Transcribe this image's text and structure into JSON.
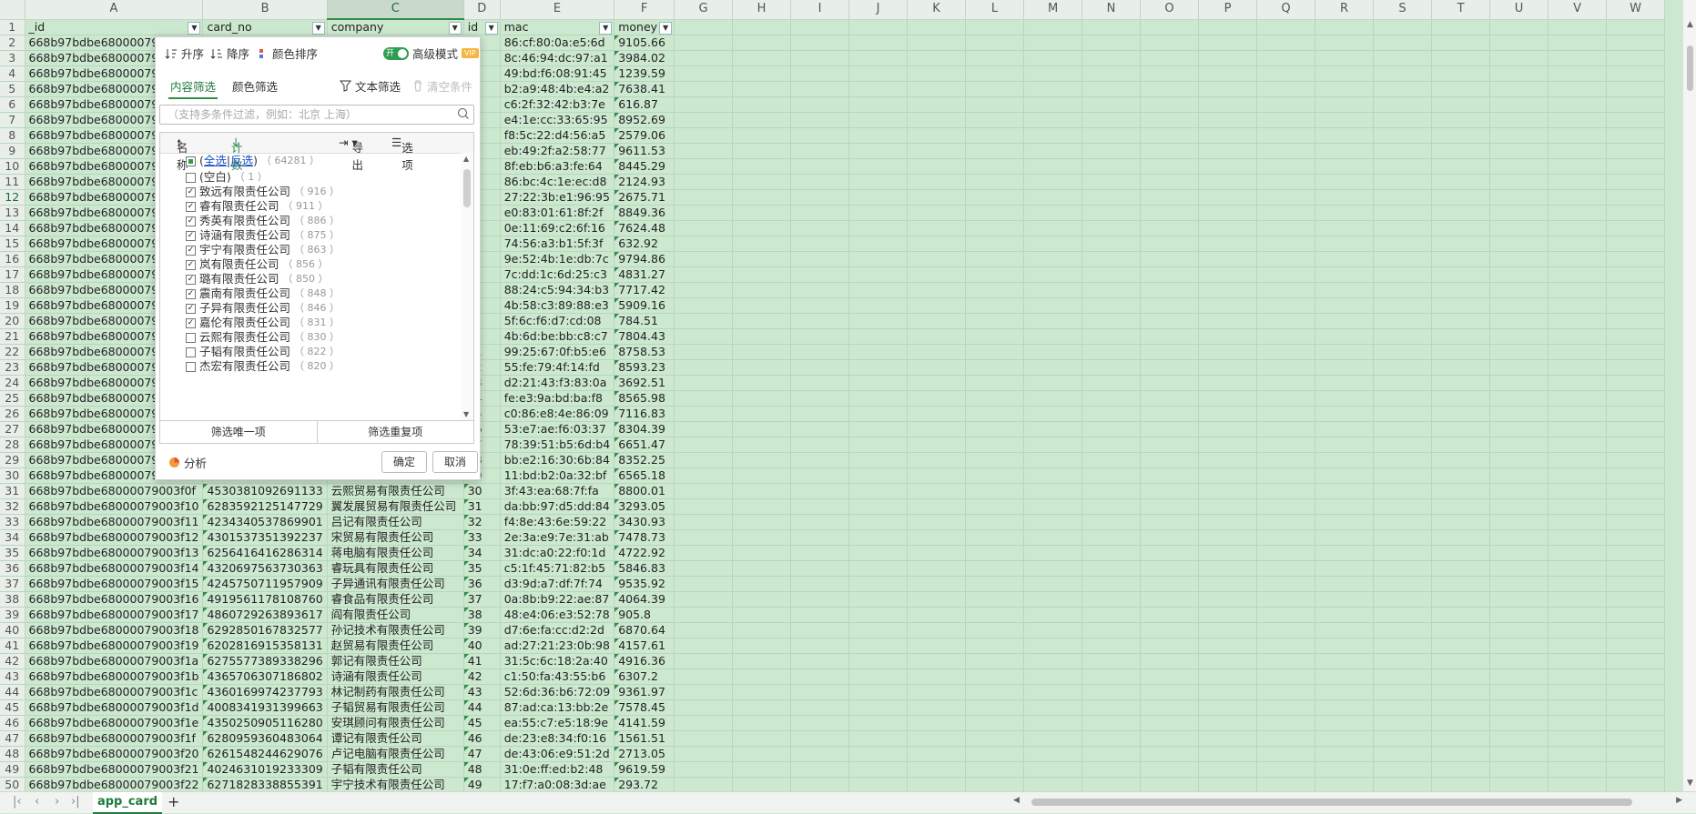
{
  "columns": [
    "A",
    "B",
    "C",
    "D",
    "E",
    "F",
    "G",
    "H",
    "I",
    "J",
    "K",
    "L",
    "M",
    "N",
    "O",
    "P",
    "Q",
    "R",
    "S",
    "T",
    "U",
    "V",
    "W"
  ],
  "headers": {
    "A": "_id",
    "B": "card_no",
    "C": "company",
    "D": "id",
    "E": "mac",
    "F": "money"
  },
  "rows": [
    {
      "r": "2",
      "a": "668b97bdbe68000079",
      "b": "",
      "c": "",
      "d": "",
      "e": "86:cf:80:0a:e5:6d",
      "f": "9105.66"
    },
    {
      "r": "3",
      "a": "668b97bdbe68000079",
      "b": "",
      "c": "",
      "d": "",
      "e": "8c:46:94:dc:97:a1",
      "f": "3984.02"
    },
    {
      "r": "4",
      "a": "668b97bdbe68000079",
      "b": "",
      "c": "",
      "d": "",
      "e": "49:bd:f6:08:91:45",
      "f": "1239.59"
    },
    {
      "r": "5",
      "a": "668b97bdbe68000079",
      "b": "",
      "c": "",
      "d": "",
      "e": "b2:a9:48:4b:e4:a2",
      "f": "7638.41"
    },
    {
      "r": "6",
      "a": "668b97bdbe68000079",
      "b": "",
      "c": "",
      "d": "",
      "e": "c6:2f:32:42:b3:7e",
      "f": "616.87"
    },
    {
      "r": "7",
      "a": "668b97bdbe68000079",
      "b": "",
      "c": "",
      "d": "",
      "e": "e4:1e:cc:33:65:95",
      "f": "8952.69"
    },
    {
      "r": "8",
      "a": "668b97bdbe68000079",
      "b": "",
      "c": "",
      "d": "",
      "e": "f8:5c:22:d4:56:a5",
      "f": "2579.06"
    },
    {
      "r": "9",
      "a": "668b97bdbe68000079",
      "b": "",
      "c": "",
      "d": "",
      "e": "eb:49:2f:a2:58:77",
      "f": "9611.53"
    },
    {
      "r": "10",
      "a": "668b97bdbe68000079",
      "b": "",
      "c": "",
      "d": "",
      "e": "8f:eb:b6:a3:fe:64",
      "f": "8445.29"
    },
    {
      "r": "11",
      "a": "668b97bdbe68000079",
      "b": "",
      "c": "",
      "d": "",
      "e": "86:bc:4c:1e:ec:d8",
      "f": "2124.93"
    },
    {
      "r": "12",
      "a": "668b97bdbe68000079",
      "b": "",
      "c": "",
      "d": "",
      "e": "27:22:3b:e1:96:95",
      "f": "2675.71"
    },
    {
      "r": "13",
      "a": "668b97bdbe68000079",
      "b": "",
      "c": "",
      "d": "",
      "e": "e0:83:01:61:8f:2f",
      "f": "8849.36"
    },
    {
      "r": "14",
      "a": "668b97bdbe68000079",
      "b": "",
      "c": "",
      "d": "",
      "e": "0e:11:69:c2:6f:16",
      "f": "7624.48"
    },
    {
      "r": "15",
      "a": "668b97bdbe68000079",
      "b": "",
      "c": "",
      "d": "",
      "e": "74:56:a3:b1:5f:3f",
      "f": "632.92"
    },
    {
      "r": "16",
      "a": "668b97bdbe68000079",
      "b": "",
      "c": "",
      "d": "",
      "e": "9e:52:4b:1e:db:7c",
      "f": "9794.86"
    },
    {
      "r": "17",
      "a": "668b97bdbe68000079",
      "b": "",
      "c": "",
      "d": "",
      "e": "7c:dd:1c:6d:25:c3",
      "f": "4831.27"
    },
    {
      "r": "18",
      "a": "668b97bdbe68000079",
      "b": "",
      "c": "",
      "d": "",
      "e": "88:24:c5:94:34:b3",
      "f": "7717.42"
    },
    {
      "r": "19",
      "a": "668b97bdbe68000079",
      "b": "",
      "c": "",
      "d": "",
      "e": "4b:58:c3:89:88:e3",
      "f": "5909.16"
    },
    {
      "r": "20",
      "a": "668b97bdbe68000079",
      "b": "",
      "c": "",
      "d": "",
      "e": "5f:6c:f6:d7:cd:08",
      "f": "784.51"
    },
    {
      "r": "21",
      "a": "668b97bdbe68000079",
      "b": "",
      "c": "",
      "d": "",
      "e": "4b:6d:be:bb:c8:c7",
      "f": "7804.43"
    },
    {
      "r": "22",
      "a": "668b97bdbe68000079",
      "b": "",
      "c": "",
      "d": "21",
      "e": "99:25:67:0f:b5:e6",
      "f": "8758.53"
    },
    {
      "r": "23",
      "a": "668b97bdbe68000079",
      "b": "",
      "c": "",
      "d": "22",
      "e": "55:fe:79:4f:14:fd",
      "f": "8593.23"
    },
    {
      "r": "24",
      "a": "668b97bdbe68000079",
      "b": "",
      "c": "",
      "d": "23",
      "e": "d2:21:43:f3:83:0a",
      "f": "3692.51"
    },
    {
      "r": "25",
      "a": "668b97bdbe68000079",
      "b": "",
      "c": "",
      "d": "24",
      "e": "fe:e3:9a:bd:ba:f8",
      "f": "8565.98"
    },
    {
      "r": "26",
      "a": "668b97bdbe68000079",
      "b": "",
      "c": "",
      "d": "25",
      "e": "c0:86:e8:4e:86:09",
      "f": "7116.83"
    },
    {
      "r": "27",
      "a": "668b97bdbe68000079",
      "b": "",
      "c": "",
      "d": "26",
      "e": "53:e7:ae:f6:03:37",
      "f": "8304.39"
    },
    {
      "r": "28",
      "a": "668b97bdbe68000079",
      "b": "",
      "c": "",
      "d": "27",
      "e": "78:39:51:b5:6d:b4",
      "f": "6651.47"
    },
    {
      "r": "29",
      "a": "668b97bdbe68000079",
      "b": "",
      "c": "",
      "d": "28",
      "e": "bb:e2:16:30:6b:84",
      "f": "8352.25"
    },
    {
      "r": "30",
      "a": "668b97bdbe68000079",
      "b": "",
      "c": "",
      "d": "29",
      "e": "11:bd:b2:0a:32:bf",
      "f": "6565.18"
    },
    {
      "r": "31",
      "a": "668b97bdbe68000079003f0f",
      "b": "4530381092691133",
      "c": "云熙贸易有限责任公司",
      "d": "30",
      "e": "3f:43:ea:68:7f:fa",
      "f": "8800.01"
    },
    {
      "r": "32",
      "a": "668b97bdbe68000079003f10",
      "b": "6283592125147729",
      "c": "翼发展贸易有限责任公司",
      "d": "31",
      "e": "da:bb:97:d5:dd:84",
      "f": "3293.05"
    },
    {
      "r": "33",
      "a": "668b97bdbe68000079003f11",
      "b": "4234340537869901",
      "c": "吕记有限责任公司",
      "d": "32",
      "e": "f4:8e:43:6e:59:22",
      "f": "3430.93"
    },
    {
      "r": "34",
      "a": "668b97bdbe68000079003f12",
      "b": "4301537351392237",
      "c": "宋贸易有限责任公司",
      "d": "33",
      "e": "2e:3a:e9:7e:31:ab",
      "f": "7478.73"
    },
    {
      "r": "35",
      "a": "668b97bdbe68000079003f13",
      "b": "6256416416286314",
      "c": "蒋电脑有限责任公司",
      "d": "34",
      "e": "31:dc:a0:22:f0:1d",
      "f": "4722.92"
    },
    {
      "r": "36",
      "a": "668b97bdbe68000079003f14",
      "b": "4320697563730363",
      "c": "睿玩具有限责任公司",
      "d": "35",
      "e": "c5:1f:45:71:82:b5",
      "f": "5846.83"
    },
    {
      "r": "37",
      "a": "668b97bdbe68000079003f15",
      "b": "4245750711957909",
      "c": "子异通讯有限责任公司",
      "d": "36",
      "e": "d3:9d:a7:df:7f:74",
      "f": "9535.92"
    },
    {
      "r": "38",
      "a": "668b97bdbe68000079003f16",
      "b": "4919561178108760",
      "c": "睿食品有限责任公司",
      "d": "37",
      "e": "0a:8b:b9:22:ae:87",
      "f": "4064.39"
    },
    {
      "r": "39",
      "a": "668b97bdbe68000079003f17",
      "b": "4860729263893617",
      "c": "阎有限责任公司",
      "d": "38",
      "e": "48:e4:06:e3:52:78",
      "f": "905.8"
    },
    {
      "r": "40",
      "a": "668b97bdbe68000079003f18",
      "b": "6292850167832577",
      "c": "孙记技术有限责任公司",
      "d": "39",
      "e": "d7:6e:fa:cc:d2:2d",
      "f": "6870.64"
    },
    {
      "r": "41",
      "a": "668b97bdbe68000079003f19",
      "b": "6202816915358131",
      "c": "赵贸易有限责任公司",
      "d": "40",
      "e": "ad:27:21:23:0b:98",
      "f": "4157.61"
    },
    {
      "r": "42",
      "a": "668b97bdbe68000079003f1a",
      "b": "6275577389338296",
      "c": "郭记有限责任公司",
      "d": "41",
      "e": "31:5c:6c:18:2a:40",
      "f": "4916.36"
    },
    {
      "r": "43",
      "a": "668b97bdbe68000079003f1b",
      "b": "4365706307186802",
      "c": "诗涵有限责任公司",
      "d": "42",
      "e": "c1:50:fa:43:55:b6",
      "f": "6307.2"
    },
    {
      "r": "44",
      "a": "668b97bdbe68000079003f1c",
      "b": "4360169974237793",
      "c": "林记制药有限责任公司",
      "d": "43",
      "e": "52:6d:36:b6:72:09",
      "f": "9361.97"
    },
    {
      "r": "45",
      "a": "668b97bdbe68000079003f1d",
      "b": "4008341931399663",
      "c": "子韬贸易有限责任公司",
      "d": "44",
      "e": "87:ad:ca:13:bb:2e",
      "f": "7578.45"
    },
    {
      "r": "46",
      "a": "668b97bdbe68000079003f1e",
      "b": "4350250905116280",
      "c": "安琪顾问有限责任公司",
      "d": "45",
      "e": "ea:55:c7:e5:18:9e",
      "f": "4141.59"
    },
    {
      "r": "47",
      "a": "668b97bdbe68000079003f1f",
      "b": "6280959360483064",
      "c": "谭记有限责任公司",
      "d": "46",
      "e": "de:23:e8:34:f0:16",
      "f": "1561.51"
    },
    {
      "r": "48",
      "a": "668b97bdbe68000079003f20",
      "b": "6261548244629076",
      "c": "卢记电脑有限责任公司",
      "d": "47",
      "e": "de:43:06:e9:51:2d",
      "f": "2713.05"
    },
    {
      "r": "49",
      "a": "668b97bdbe68000079003f21",
      "b": "4024631019233309",
      "c": "子韬有限责任公司",
      "d": "48",
      "e": "31:0e:ff:ed:b2:48",
      "f": "9619.59"
    },
    {
      "r": "50",
      "a": "668b97bdbe68000079003f22",
      "b": "6271828338855391",
      "c": "宇宁技术有限责任公司",
      "d": "49",
      "e": "17:f7:a0:08:3d:ae",
      "f": "293.72"
    }
  ],
  "filter": {
    "sort_asc": "升序",
    "sort_desc": "降序",
    "color_sort": "颜色排序",
    "toggle_on": "开",
    "advanced_mode": "高级模式",
    "vip": "VIP",
    "tab_content": "内容筛选",
    "tab_color": "颜色筛选",
    "text_filter": "文本筛选",
    "clear_conditions": "清空条件",
    "search_placeholder": "（支持多条件过滤，例如：北京  上海）",
    "col_name": "名称",
    "col_count": "计数",
    "export": "导出",
    "options": "选项",
    "select_all": "全选",
    "invert": "反选",
    "all_count": "（ 64281 ）",
    "items": [
      {
        "label": "(空白)",
        "count": "（ 1 ）",
        "checked": false
      },
      {
        "label": "致远有限责任公司",
        "count": "（ 916 ）",
        "checked": true
      },
      {
        "label": "睿有限责任公司",
        "count": "（ 911 ）",
        "checked": true
      },
      {
        "label": "秀英有限责任公司",
        "count": "（ 886 ）",
        "checked": true
      },
      {
        "label": "诗涵有限责任公司",
        "count": "（ 875 ）",
        "checked": true
      },
      {
        "label": "宇宁有限责任公司",
        "count": "（ 863 ）",
        "checked": true
      },
      {
        "label": "岚有限责任公司",
        "count": "（ 856 ）",
        "checked": true
      },
      {
        "label": "璐有限责任公司",
        "count": "（ 850 ）",
        "checked": true
      },
      {
        "label": "震南有限责任公司",
        "count": "（ 848 ）",
        "checked": true
      },
      {
        "label": "子异有限责任公司",
        "count": "（ 846 ）",
        "checked": true
      },
      {
        "label": "嘉伦有限责任公司",
        "count": "（ 831 ）",
        "checked": true
      },
      {
        "label": "云熙有限责任公司",
        "count": "（ 830 ）",
        "checked": false
      },
      {
        "label": "子韬有限责任公司",
        "count": "（ 822 ）",
        "checked": false
      },
      {
        "label": "杰宏有限责任公司",
        "count": "（ 820 ）",
        "checked": false
      }
    ],
    "unique_btn": "筛选唯一项",
    "dup_btn": "筛选重复项",
    "analyze": "分析",
    "ok": "确定",
    "cancel": "取消"
  },
  "sheet_tab": "app_card"
}
